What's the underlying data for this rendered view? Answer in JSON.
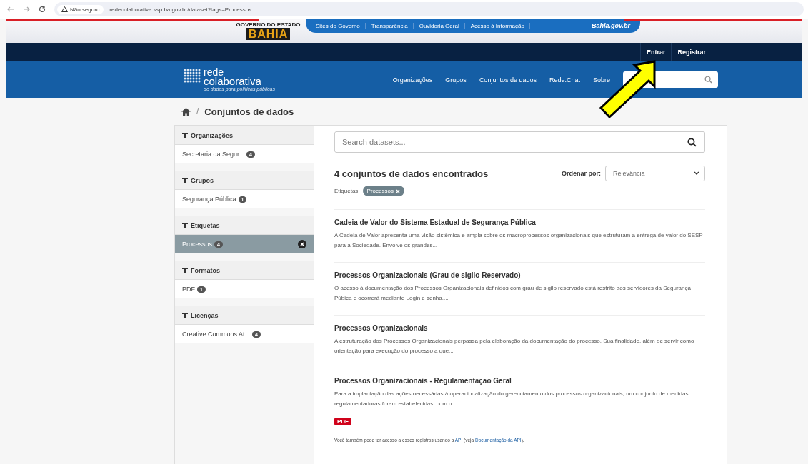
{
  "browser": {
    "security": "Não seguro",
    "url": "redecolaborativa.ssp.ba.gov.br/dataset?tags=Processos"
  },
  "gov_bar": {
    "logo_top": "GOVERNO DO ESTADO",
    "logo_main": "BAHIA",
    "links": [
      "Sites do Governo",
      "Transparência",
      "Ouvidoria Geral",
      "Acesso à Informação"
    ],
    "site": "Bahia.gov.br"
  },
  "account": [
    "Entrar",
    "Registrar"
  ],
  "header": {
    "logo_line1": "rede",
    "logo_line2": "colaborativa",
    "logo_tagline": "de dados para políticas públicas",
    "nav": [
      "Organizações",
      "Grupos",
      "Conjuntos de dados",
      "Rede.Chat",
      "Sobre"
    ]
  },
  "breadcrumb": {
    "separator": "/",
    "current": "Conjuntos de dados"
  },
  "facets": [
    {
      "title": "Organizações",
      "items": [
        {
          "label": "Secretaria da Segur...",
          "count": "4",
          "selected": false
        }
      ]
    },
    {
      "title": "Grupos",
      "items": [
        {
          "label": "Segurança Pública",
          "count": "1",
          "selected": false
        }
      ]
    },
    {
      "title": "Etiquetas",
      "items": [
        {
          "label": "Processos",
          "count": "4",
          "selected": true
        }
      ]
    },
    {
      "title": "Formatos",
      "items": [
        {
          "label": "PDF",
          "count": "1",
          "selected": false
        }
      ]
    },
    {
      "title": "Licenças",
      "items": [
        {
          "label": "Creative Commons At...",
          "count": "4",
          "selected": false
        }
      ]
    }
  ],
  "search": {
    "placeholder": "Search datasets..."
  },
  "results_heading": "4 conjuntos de dados encontrados",
  "sort": {
    "label": "Ordenar por:",
    "value": "Relevância"
  },
  "filter": {
    "label": "Etiquetas:",
    "tag": "Processos"
  },
  "datasets": [
    {
      "title": "Cadeia de Valor do Sistema Estadual de Segurança Pública",
      "description": "A Cadeia de Valor apresenta uma visão sistêmica e ampla sobre os macroprocessos organizacionais que estruturam a entrega de valor do SESP para a Sociedade. Envolve os grandes..."
    },
    {
      "title": "Processos Organizacionais (Grau de sigilo Reservado)",
      "description": "O acesso à documentação dos Processos Organizacionais definidos com grau de sigilo reservado está restrito aos servidores da Segurança Púbica e ocorrerá mediante Login e senha...."
    },
    {
      "title": "Processos Organizacionais",
      "description": "A estruturação dos Processos Organizacionais perpassa pela elaboração da documentação do processo. Sua finalidade, além de servir como orientação para execução do processo a que..."
    },
    {
      "title": "Processos Organizacionais - Regulamentação Geral",
      "description": "Para a implantação das ações necessárias à operacionalização do gerenciamento dos processos organizacionais, um conjunto de medidas regulamentadoras foram estabelecidas, com o...",
      "formats": [
        "PDF"
      ]
    }
  ],
  "api_note": {
    "before": "Você também pode ter acesso a esses registros usando a",
    "link1": "API",
    "middle": "(veja",
    "link2": "Documentação da API",
    "after": ")."
  }
}
